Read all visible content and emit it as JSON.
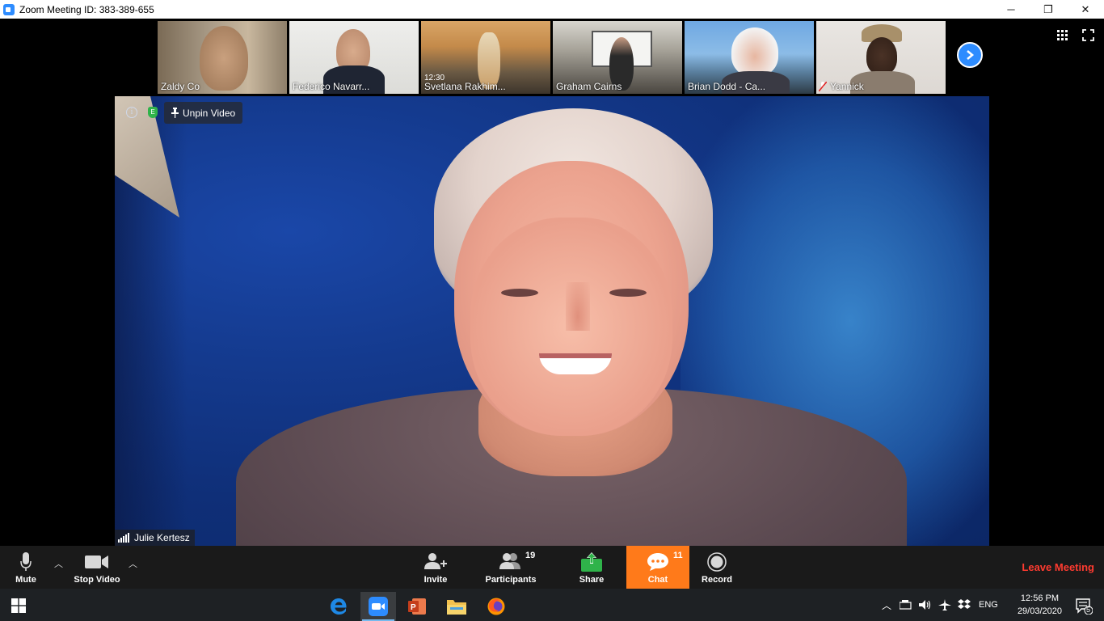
{
  "window": {
    "title": "Zoom Meeting ID: 383-389-655",
    "minimize": "─",
    "restore": "❐",
    "close": "✕"
  },
  "thumbnails": [
    {
      "name": "Zaldy Co"
    },
    {
      "name": "Federico Navarr..."
    },
    {
      "name": "Svetlana Rakhim...",
      "clock": "12:30"
    },
    {
      "name": "Graham Cairns"
    },
    {
      "name": "Brian Dodd - Ca..."
    },
    {
      "name": "Yannick"
    }
  ],
  "main_video": {
    "unpin_label": "Unpin Video",
    "info_glyph": "i",
    "shield_glyph": "E",
    "speaker_name": "Julie Kertesz"
  },
  "controls": {
    "mute": "Mute",
    "stop_video": "Stop Video",
    "invite": "Invite",
    "participants": "Participants",
    "participants_count": "19",
    "share": "Share",
    "chat": "Chat",
    "chat_count": "11",
    "record": "Record",
    "leave": "Leave Meeting"
  },
  "taskbar": {
    "lang": "ENG",
    "time": "12:56 PM",
    "date": "29/03/2020",
    "notification_count": "5"
  },
  "colors": {
    "zoom_blue": "#2d8cff",
    "chat_orange": "#ff7a1a",
    "leave_red": "#ff3b30",
    "share_green": "#2fb34a"
  }
}
